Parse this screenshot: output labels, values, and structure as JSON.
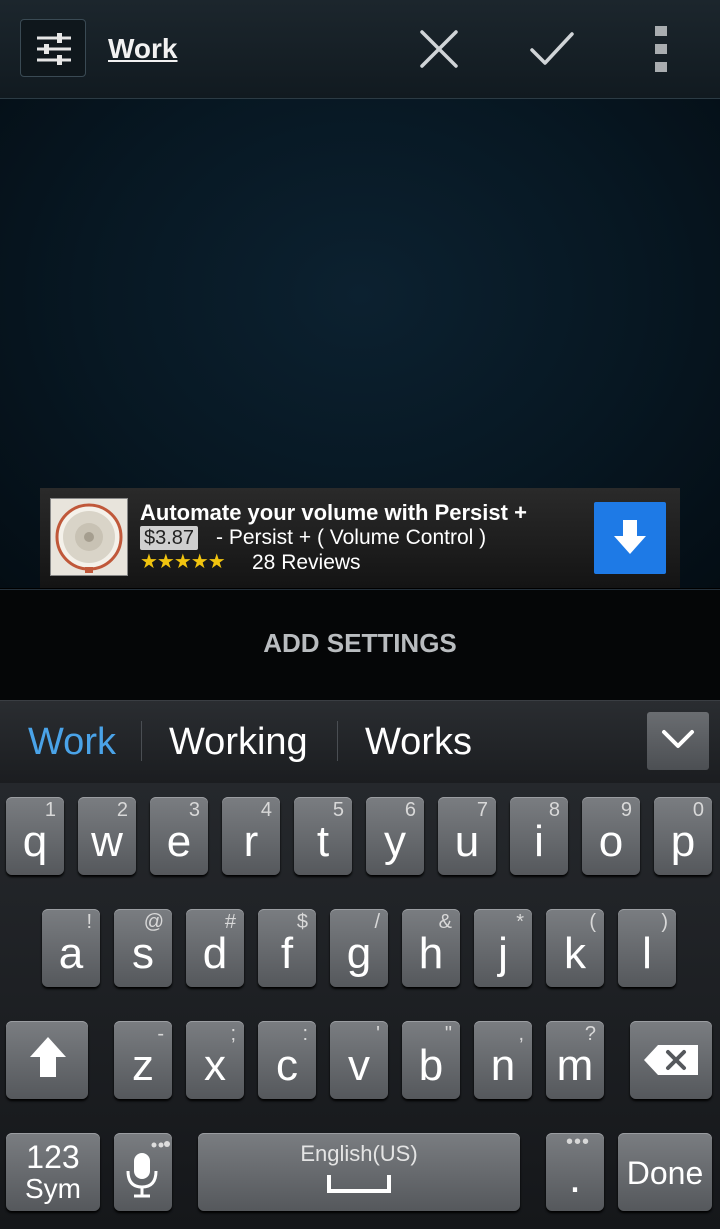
{
  "action_bar": {
    "title": "Work",
    "settings_icon": "sliders-icon",
    "cancel_icon": "close-icon",
    "confirm_icon": "check-icon",
    "menu_icon": "overflow-menu-icon"
  },
  "ad": {
    "title": "Automate your volume with Persist +",
    "price": "$3.87",
    "subtitle": "- Persist + ( Volume Control )",
    "stars": "★★★★★",
    "reviews": "28 Reviews",
    "download_icon": "download-arrow-icon",
    "accent": "#1e7ae6"
  },
  "add_settings_label": "ADD SETTINGS",
  "suggestions": {
    "items": [
      "Work",
      "Working",
      "Works"
    ],
    "highlight_color": "#4aa3e8",
    "collapse_icon": "chevron-down-icon"
  },
  "keyboard": {
    "row1": [
      {
        "k": "q",
        "a": "1"
      },
      {
        "k": "w",
        "a": "2"
      },
      {
        "k": "e",
        "a": "3"
      },
      {
        "k": "r",
        "a": "4"
      },
      {
        "k": "t",
        "a": "5"
      },
      {
        "k": "y",
        "a": "6"
      },
      {
        "k": "u",
        "a": "7"
      },
      {
        "k": "i",
        "a": "8"
      },
      {
        "k": "o",
        "a": "9"
      },
      {
        "k": "p",
        "a": "0"
      }
    ],
    "row2": [
      {
        "k": "a",
        "a": "!"
      },
      {
        "k": "s",
        "a": "@"
      },
      {
        "k": "d",
        "a": "#"
      },
      {
        "k": "f",
        "a": "$"
      },
      {
        "k": "g",
        "a": "/"
      },
      {
        "k": "h",
        "a": "&"
      },
      {
        "k": "j",
        "a": "*"
      },
      {
        "k": "k",
        "a": "("
      },
      {
        "k": "l",
        "a": ")"
      }
    ],
    "row3": [
      {
        "k": "z",
        "a": "-"
      },
      {
        "k": "x",
        "a": ";"
      },
      {
        "k": "c",
        "a": ":"
      },
      {
        "k": "v",
        "a": "'"
      },
      {
        "k": "b",
        "a": "\""
      },
      {
        "k": "n",
        "a": ","
      },
      {
        "k": "m",
        "a": "?"
      }
    ],
    "sym_label_top": "123",
    "sym_label_bottom": "Sym",
    "space_label": "English(US)",
    "period_label": ".",
    "done_label": "Done",
    "shift_icon": "shift-arrow-icon",
    "backspace_icon": "backspace-icon",
    "mic_icon": "microphone-icon"
  }
}
